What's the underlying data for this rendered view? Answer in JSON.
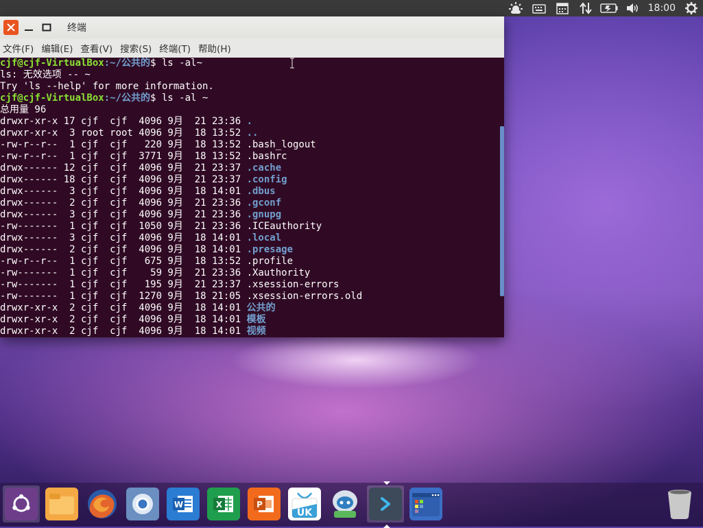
{
  "panel": {
    "clock": "18:00",
    "icons": [
      "weather-icon",
      "keyboard-icon",
      "calendar-icon",
      "network-icon",
      "battery-icon",
      "volume-icon",
      "settings-gear-icon"
    ]
  },
  "window": {
    "title": "终端",
    "menu": [
      "文件(F)",
      "编辑(E)",
      "查看(V)",
      "搜索(S)",
      "终端(T)",
      "帮助(H)"
    ]
  },
  "terminal": {
    "prompt_user": "cjf@cjf-VirtualBox",
    "prompt_path": ":~/公共的",
    "cmd1": "$ ls -al~",
    "err1": "ls: 无效选项 -- ~",
    "err2": "Try 'ls --help' for more information.",
    "cmd2": "$ ls -al ~",
    "total": "总用量 96",
    "rows": [
      {
        "meta": "drwxr-xr-x 17 cjf  cjf  4096 9月  21 23:36 ",
        "name": ".",
        "dir": true
      },
      {
        "meta": "drwxr-xr-x  3 root root 4096 9月  18 13:52 ",
        "name": "..",
        "dir": true
      },
      {
        "meta": "-rw-r--r--  1 cjf  cjf   220 9月  18 13:52 ",
        "name": ".bash_logout",
        "dir": false
      },
      {
        "meta": "-rw-r--r--  1 cjf  cjf  3771 9月  18 13:52 ",
        "name": ".bashrc",
        "dir": false
      },
      {
        "meta": "drwx------ 12 cjf  cjf  4096 9月  21 23:37 ",
        "name": ".cache",
        "dir": true
      },
      {
        "meta": "drwx------ 18 cjf  cjf  4096 9月  21 23:37 ",
        "name": ".config",
        "dir": true
      },
      {
        "meta": "drwx------  3 cjf  cjf  4096 9月  18 14:01 ",
        "name": ".dbus",
        "dir": true
      },
      {
        "meta": "drwx------  2 cjf  cjf  4096 9月  21 23:36 ",
        "name": ".gconf",
        "dir": true
      },
      {
        "meta": "drwx------  3 cjf  cjf  4096 9月  21 23:36 ",
        "name": ".gnupg",
        "dir": true
      },
      {
        "meta": "-rw-------  1 cjf  cjf  1050 9月  21 23:36 ",
        "name": ".ICEauthority",
        "dir": false
      },
      {
        "meta": "drwx------  3 cjf  cjf  4096 9月  18 14:01 ",
        "name": ".local",
        "dir": true
      },
      {
        "meta": "drwx------  2 cjf  cjf  4096 9月  18 14:01 ",
        "name": ".presage",
        "dir": true
      },
      {
        "meta": "-rw-r--r--  1 cjf  cjf   675 9月  18 13:52 ",
        "name": ".profile",
        "dir": false
      },
      {
        "meta": "-rw-------  1 cjf  cjf    59 9月  21 23:36 ",
        "name": ".Xauthority",
        "dir": false
      },
      {
        "meta": "-rw-------  1 cjf  cjf   195 9月  21 23:37 ",
        "name": ".xsession-errors",
        "dir": false
      },
      {
        "meta": "-rw-------  1 cjf  cjf  1270 9月  18 21:05 ",
        "name": ".xsession-errors.old",
        "dir": false
      },
      {
        "meta": "drwxr-xr-x  2 cjf  cjf  4096 9月  18 14:01 ",
        "name": "公共的",
        "dir": true
      },
      {
        "meta": "drwxr-xr-x  2 cjf  cjf  4096 9月  18 14:01 ",
        "name": "模板",
        "dir": true
      },
      {
        "meta": "drwxr-xr-x  2 cjf  cjf  4096 9月  18 14:01 ",
        "name": "视频",
        "dir": true
      }
    ]
  },
  "dock": {
    "items": [
      {
        "name": "ubuntu-logo-icon",
        "color": "#6d3d8a"
      },
      {
        "name": "files-icon",
        "color": "#f5a945"
      },
      {
        "name": "firefox-icon",
        "color": "#e3642c"
      },
      {
        "name": "chromium-icon",
        "color": "#6a8fc0"
      },
      {
        "name": "word-icon",
        "color": "#2b7cd3"
      },
      {
        "name": "excel-icon",
        "color": "#1f9e4d"
      },
      {
        "name": "powerpoint-icon",
        "color": "#f26b1d"
      },
      {
        "name": "ubuntu-software-icon",
        "color": "#ffffff"
      },
      {
        "name": "uk-software-icon",
        "color": "#3aa0d8"
      },
      {
        "name": "terminal-icon",
        "color": "#3c4a5a"
      },
      {
        "name": "workspace-switcher-icon",
        "color": "#3b6ec5"
      },
      {
        "name": "trash-icon",
        "color": "#b9b9b9"
      }
    ],
    "uk_label": "UK"
  }
}
